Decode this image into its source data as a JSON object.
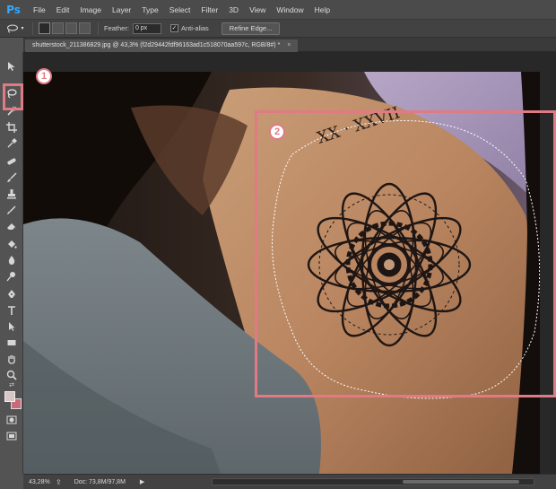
{
  "app": {
    "logo": "Ps",
    "menu": [
      "File",
      "Edit",
      "Image",
      "Layer",
      "Type",
      "Select",
      "Filter",
      "3D",
      "View",
      "Window",
      "Help"
    ]
  },
  "options_bar": {
    "current_tool_icon": "lasso-icon",
    "feather_label": "Feather:",
    "feather_value": "0 px",
    "antialias_label": "Anti-alias",
    "antialias_checked": true,
    "refine_edge_label": "Refine Edge..."
  },
  "document": {
    "tab_title": "shutterstock_211386829.jpg @ 43,3% (f2d29442fdf96163ad1c518070aa597c, RGB/8#) *",
    "close_glyph": "×"
  },
  "toolbox": {
    "tools": [
      "move-tool",
      "lasso-tool",
      "quick-selection-tool",
      "crop-tool",
      "eyedropper-tool",
      "spot-healing-tool",
      "brush-tool",
      "clone-stamp-tool",
      "history-brush-tool",
      "eraser-tool",
      "paint-bucket-tool",
      "blur-tool",
      "dodge-tool",
      "pen-tool",
      "type-tool",
      "path-selection-tool",
      "rectangle-tool",
      "hand-tool",
      "zoom-tool"
    ],
    "foreground_color": "#d8c6c4",
    "background_color": "#c96a7a"
  },
  "status_bar": {
    "zoom": "43,28%",
    "doc_info": "Doc: 73,8M/97,8M",
    "arrow": "▶"
  },
  "callouts": {
    "step1": "1",
    "step2": "2",
    "accent_color": "#e07a85"
  },
  "image": {
    "tattoo_text": "XX · XXVII"
  }
}
